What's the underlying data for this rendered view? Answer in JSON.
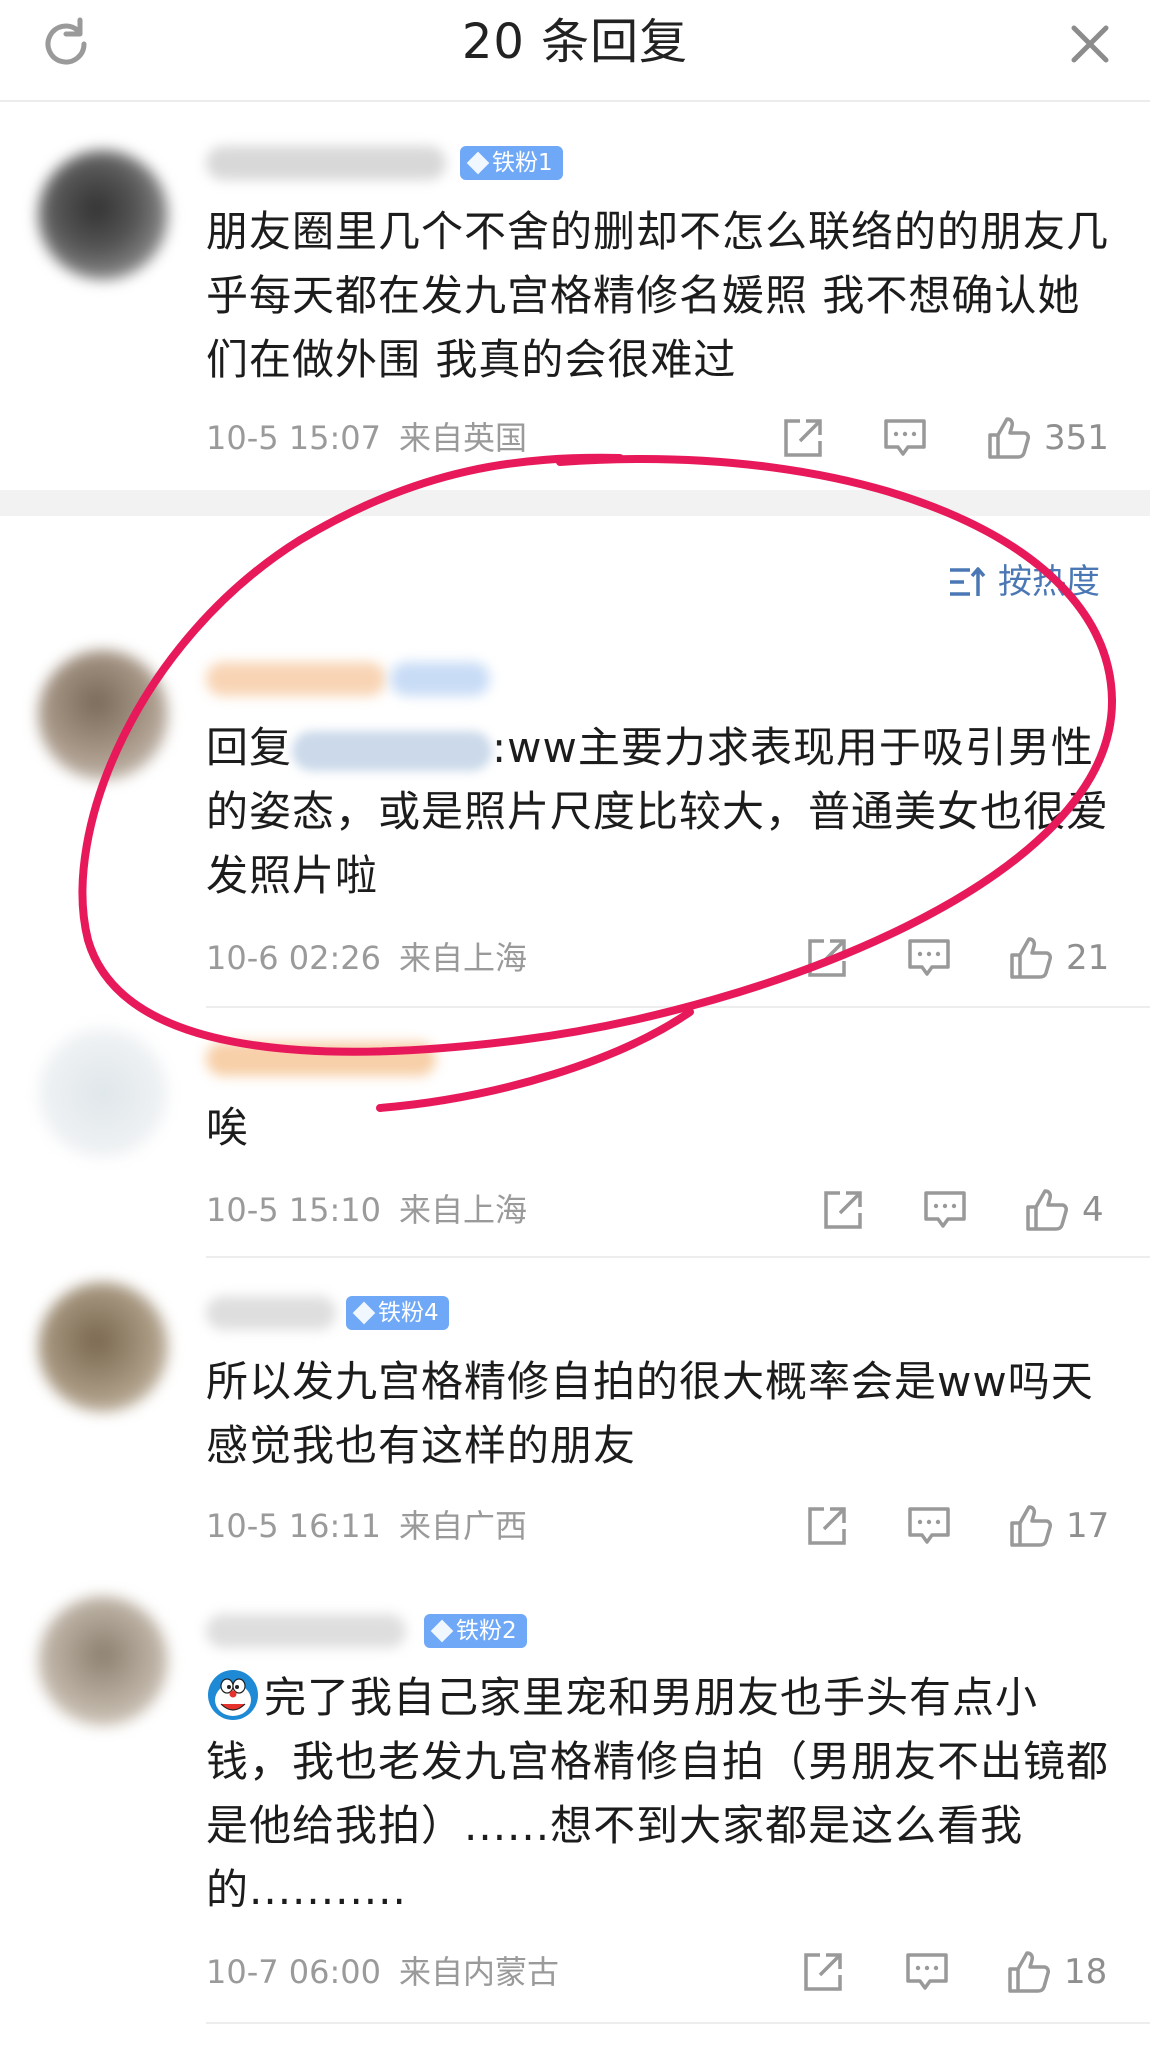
{
  "header": {
    "title": "20 条回复",
    "refresh_icon": "refresh-icon",
    "close_icon": "close-icon"
  },
  "sort": {
    "label": "按热度",
    "icon": "sort-icon"
  },
  "colors": {
    "badge": "#6ea8f7",
    "sort": "#4b78b4",
    "annotation": "#e8195b"
  },
  "comments": [
    {
      "badge": "铁粉1",
      "text": "朋友圈里几个不舍的删却不怎么联络的的朋友几乎每天都在发九宫格精修名媛照 我不想确认她们在做外围 我真的会很难过",
      "date": "10-5 15:07",
      "location": "来自英国",
      "likes": "351"
    },
    {
      "reply_prefix": "回复",
      "text": ":ww主要力求表现用于吸引男性的姿态，或是照片尺度比较大，普通美女也很爱发照片啦",
      "date": "10-6 02:26",
      "location": "来自上海",
      "likes": "21"
    },
    {
      "text": "唉",
      "date": "10-5 15:10",
      "location": "来自上海",
      "likes": "4"
    },
    {
      "badge": "铁粉4",
      "text": "所以发九宫格精修自拍的很大概率会是ww吗天 感觉我也有这样的朋友",
      "date": "10-5 16:11",
      "location": "来自广西",
      "likes": "17"
    },
    {
      "badge": "铁粉2",
      "text": "完了我自己家里宠和男朋友也手头有点小钱，我也老发九宫格精修自拍（男朋友不出镜都是他给我拍）......想不到大家都是这么看我的...........",
      "date": "10-7 06:00",
      "location": "来自内蒙古",
      "likes": "18"
    }
  ]
}
